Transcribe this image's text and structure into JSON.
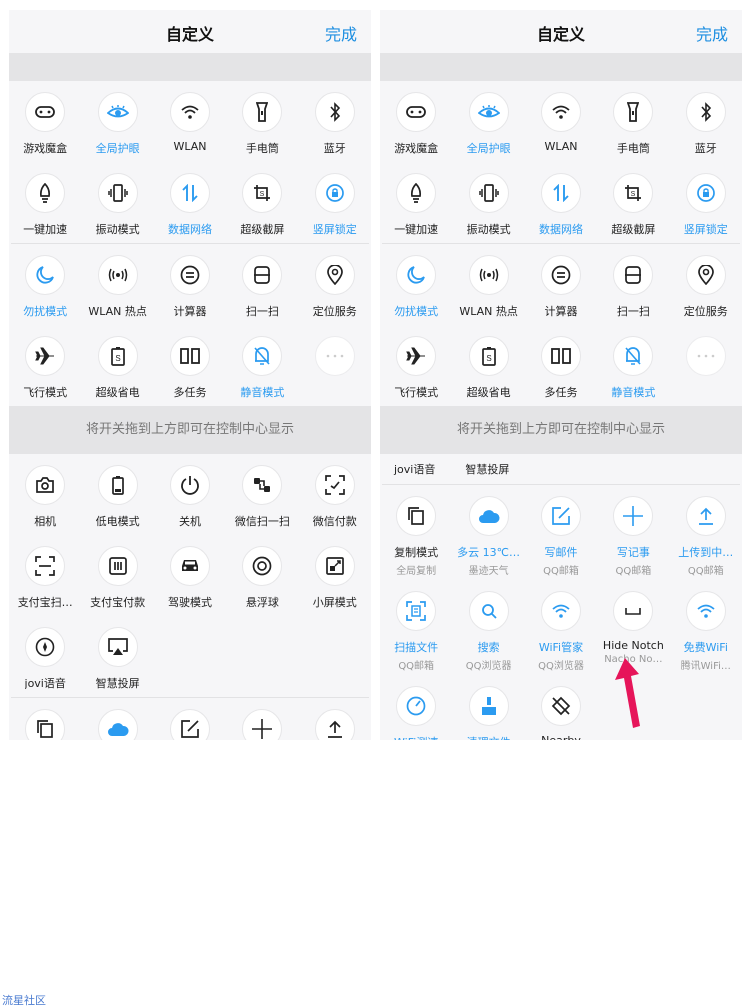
{
  "header": {
    "title": "自定义",
    "done_label": "完成"
  },
  "hint_text": "将开关拖到上方即可在控制中心显示",
  "watermark": "流星社区",
  "colors": {
    "accent": "#2b9bf0",
    "arrow": "#e6155a"
  },
  "active_tiles": [
    {
      "label": "游戏魔盒",
      "icon": "gamepad-icon",
      "on": false
    },
    {
      "label": "全局护眼",
      "icon": "eye-icon",
      "on": true
    },
    {
      "label": "WLAN",
      "icon": "wifi-icon",
      "on": false
    },
    {
      "label": "手电筒",
      "icon": "flashlight-icon",
      "on": false
    },
    {
      "label": "蓝牙",
      "icon": "bluetooth-icon",
      "on": false
    },
    {
      "label": "一键加速",
      "icon": "rocket-icon",
      "on": false
    },
    {
      "label": "振动模式",
      "icon": "vibrate-icon",
      "on": false
    },
    {
      "label": "数据网络",
      "icon": "data-network-icon",
      "on": true
    },
    {
      "label": "超级截屏",
      "icon": "screenshot-icon",
      "on": false
    },
    {
      "label": "竖屏锁定",
      "icon": "rotation-lock-icon",
      "on": true
    },
    {
      "label": "勿扰模式",
      "icon": "moon-icon",
      "on": true
    },
    {
      "label": "WLAN 热点",
      "icon": "hotspot-icon",
      "on": false
    },
    {
      "label": "计算器",
      "icon": "calculator-icon",
      "on": false
    },
    {
      "label": "扫一扫",
      "icon": "scan-icon",
      "on": false
    },
    {
      "label": "定位服务",
      "icon": "location-icon",
      "on": false
    },
    {
      "label": "飞行模式",
      "icon": "airplane-icon",
      "on": false
    },
    {
      "label": "超级省电",
      "icon": "battery-saver-icon",
      "on": false
    },
    {
      "label": "多任务",
      "icon": "multitask-icon",
      "on": false
    },
    {
      "label": "静音模式",
      "icon": "mute-bell-icon",
      "on": true
    },
    {
      "label": "",
      "icon": "more-icon",
      "on": false
    }
  ],
  "left_inactive_tiles": [
    {
      "label": "相机",
      "icon": "camera-icon"
    },
    {
      "label": "低电模式",
      "icon": "low-battery-icon"
    },
    {
      "label": "关机",
      "icon": "power-icon"
    },
    {
      "label": "微信扫一扫",
      "icon": "wechat-scan-icon"
    },
    {
      "label": "微信付款",
      "icon": "wechat-pay-icon"
    },
    {
      "label": "支付宝扫…",
      "icon": "alipay-scan-icon"
    },
    {
      "label": "支付宝付款",
      "icon": "alipay-pay-icon"
    },
    {
      "label": "驾驶模式",
      "icon": "car-icon"
    },
    {
      "label": "悬浮球",
      "icon": "float-ball-icon"
    },
    {
      "label": "小屏模式",
      "icon": "small-screen-icon"
    },
    {
      "label": "jovi语音",
      "icon": "jovi-voice-icon"
    },
    {
      "label": "智慧投屏",
      "icon": "screencast-icon"
    }
  ],
  "left_bottom_icons": [
    "copy-icon",
    "cloud-icon",
    "edit-icon",
    "plus-icon",
    "upload-icon"
  ],
  "right_text_items": [
    "jovi语音",
    "智慧投屏"
  ],
  "right_app_tiles": [
    {
      "label": "复制模式",
      "sub": "全局复制",
      "icon": "copy-icon",
      "blue": false
    },
    {
      "label": "多云 13℃…",
      "sub": "墨迹天气",
      "icon": "cloud-icon",
      "blue": true
    },
    {
      "label": "写邮件",
      "sub": "QQ邮箱",
      "icon": "edit-icon",
      "blue": true
    },
    {
      "label": "写记事",
      "sub": "QQ邮箱",
      "icon": "plus-icon",
      "blue": true
    },
    {
      "label": "上传到中…",
      "sub": "QQ邮箱",
      "icon": "upload-icon",
      "blue": true
    },
    {
      "label": "扫描文件",
      "sub": "QQ邮箱",
      "icon": "scan-doc-icon",
      "blue": true
    },
    {
      "label": "搜索",
      "sub": "QQ浏览器",
      "icon": "search-icon",
      "blue": true
    },
    {
      "label": "WiFi管家",
      "sub": "QQ浏览器",
      "icon": "wifi-icon",
      "blue": true
    },
    {
      "label": "Hide Notch",
      "sub": "Nacho No…",
      "icon": "notch-icon",
      "blue": false
    },
    {
      "label": "免费WiFi",
      "sub": "腾讯WiFi…",
      "icon": "wifi-icon",
      "blue": true
    },
    {
      "label": "WiFi测速",
      "sub": "",
      "icon": "speed-icon",
      "blue": true
    },
    {
      "label": "清理文件",
      "sub": "",
      "icon": "clean-icon",
      "blue": true
    },
    {
      "label": "Nearby",
      "sub": "",
      "icon": "nearby-icon",
      "blue": false
    }
  ]
}
